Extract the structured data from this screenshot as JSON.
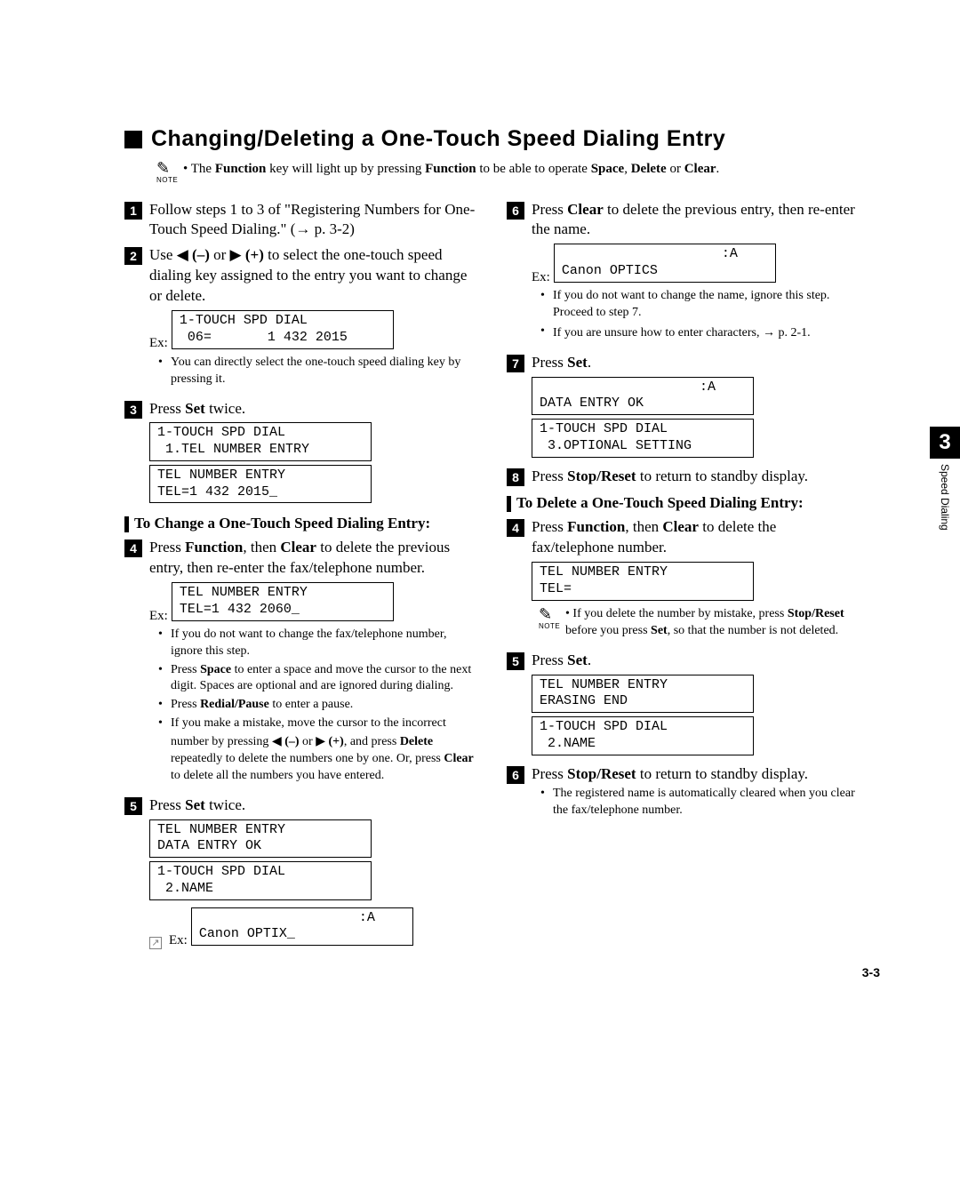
{
  "heading": "Changing/Deleting a One-Touch Speed Dialing Entry",
  "note_top": "• The Function key will light up by pressing Function to be able to operate Space, Delete or Clear.",
  "note_label": "NOTE",
  "ex": "Ex:",
  "left": {
    "s1": "Follow steps 1 to 3 of \"Registering Numbers for One-Touch Speed Dialing.\" (→ p. 3-2)",
    "s2": "Use ◀ (–) or ▶ (+) to select the one-touch speed dialing key assigned to the entry you want to change or delete.",
    "lcd2": "1-TOUCH SPD DIAL\n 06=       1 432 2015",
    "b2a": "You can directly select the one-touch speed dialing key by pressing it.",
    "s3": "Press Set twice.",
    "lcd3a": "1-TOUCH SPD DIAL\n 1.TEL NUMBER ENTRY",
    "lcd3b": "TEL NUMBER ENTRY\nTEL=1 432 2015_",
    "sub1_h": "To Change a One-Touch Speed Dialing Entry:",
    "s4": "Press Function, then Clear to delete the previous entry, then re-enter the fax/telephone number.",
    "lcd4": "TEL NUMBER ENTRY\nTEL=1 432 2060_",
    "b4a": "If you do not want to change the fax/telephone number, ignore this step.",
    "b4b": "Press Space to enter a space and move the cursor to the next digit. Spaces are optional and are ignored during dialing.",
    "b4c": "Press Redial/Pause to enter a pause.",
    "b4d": "If you make a mistake, move the cursor to the incorrect number by pressing ◀ (–) or ▶ (+), and press Delete repeatedly to delete the numbers one by one. Or, press Clear to delete all the numbers you have entered.",
    "s5": "Press Set twice.",
    "lcd5a": "TEL NUMBER ENTRY\nDATA ENTRY OK",
    "lcd5b": "1-TOUCH SPD DIAL\n 2.NAME",
    "lcd5c": "                    :A\nCanon OPTIX_"
  },
  "right": {
    "s6": "Press Clear to delete the previous entry, then re-enter the name.",
    "lcd6": "                    :A\nCanon OPTICS",
    "b6a": "If you do not want to change the name, ignore this step. Proceed to step 7.",
    "b6b": "If you are unsure how to enter characters, → p. 2-1.",
    "s7": "Press Set.",
    "lcd7a": "                    :A\nDATA ENTRY OK",
    "lcd7b": "1-TOUCH SPD DIAL\n 3.OPTIONAL SETTING",
    "s8": "Press Stop/Reset to return to standby display.",
    "sub2_h": "To Delete a One-Touch Speed Dialing Entry:",
    "s4b": "Press Function, then Clear to delete the fax/telephone number.",
    "lcd4b": "TEL NUMBER ENTRY\nTEL=",
    "note4b": "If you delete the number by mistake, press Stop/Reset before you press Set, so that the number is not deleted.",
    "s5b": "Press Set.",
    "lcd5ba": "TEL NUMBER ENTRY\nERASING END",
    "lcd5bb": "1-TOUCH SPD DIAL\n 2.NAME",
    "s6b": "Press Stop/Reset to return to standby display.",
    "b6ba": "The registered name is automatically cleared when you clear the fax/telephone number."
  },
  "tab_num": "3",
  "tab_label": "Speed Dialing",
  "page_num": "3-3"
}
